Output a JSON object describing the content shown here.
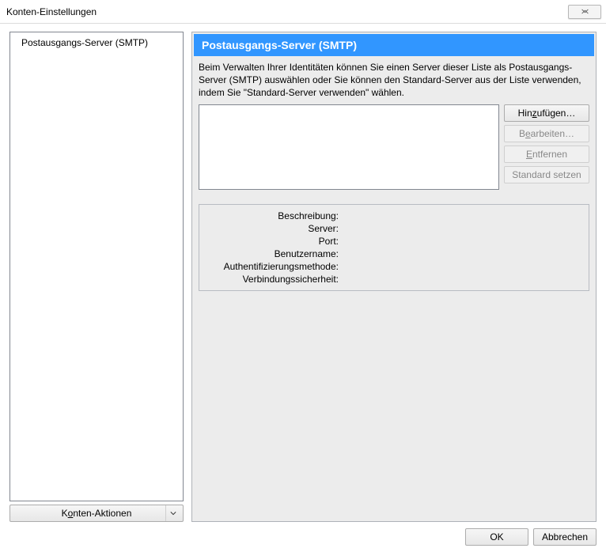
{
  "window": {
    "title": "Konten-Einstellungen"
  },
  "tree": {
    "items": [
      {
        "label": "Postausgangs-Server (SMTP)"
      }
    ]
  },
  "actions": {
    "label_pre": "K",
    "label_u": "o",
    "label_post": "nten-Aktionen"
  },
  "panel": {
    "header": "Postausgangs-Server (SMTP)",
    "description": "Beim Verwalten Ihrer Identitäten können Sie einen Server dieser Liste als Postausgangs-Server (SMTP) auswählen oder Sie können den Standard-Server aus der Liste verwenden, indem Sie \"Standard-Server verwenden\" wählen."
  },
  "buttons": {
    "add_pre": "Hin",
    "add_u": "z",
    "add_post": "ufügen…",
    "edit_pre": "B",
    "edit_u": "e",
    "edit_post": "arbeiten…",
    "remove_pre": "",
    "remove_u": "E",
    "remove_post": "ntfernen",
    "default": "Standard setzen"
  },
  "details": {
    "labels": {
      "beschreibung": "Beschreibung:",
      "server": "Server:",
      "port": "Port:",
      "benutzer": "Benutzername:",
      "auth": "Authentifizierungsmethode:",
      "sec": "Verbindungssicherheit:"
    },
    "values": {
      "beschreibung": "",
      "server": "",
      "port": "",
      "benutzer": "",
      "auth": "",
      "sec": ""
    }
  },
  "dialog": {
    "ok": "OK",
    "cancel": "Abbrechen"
  }
}
